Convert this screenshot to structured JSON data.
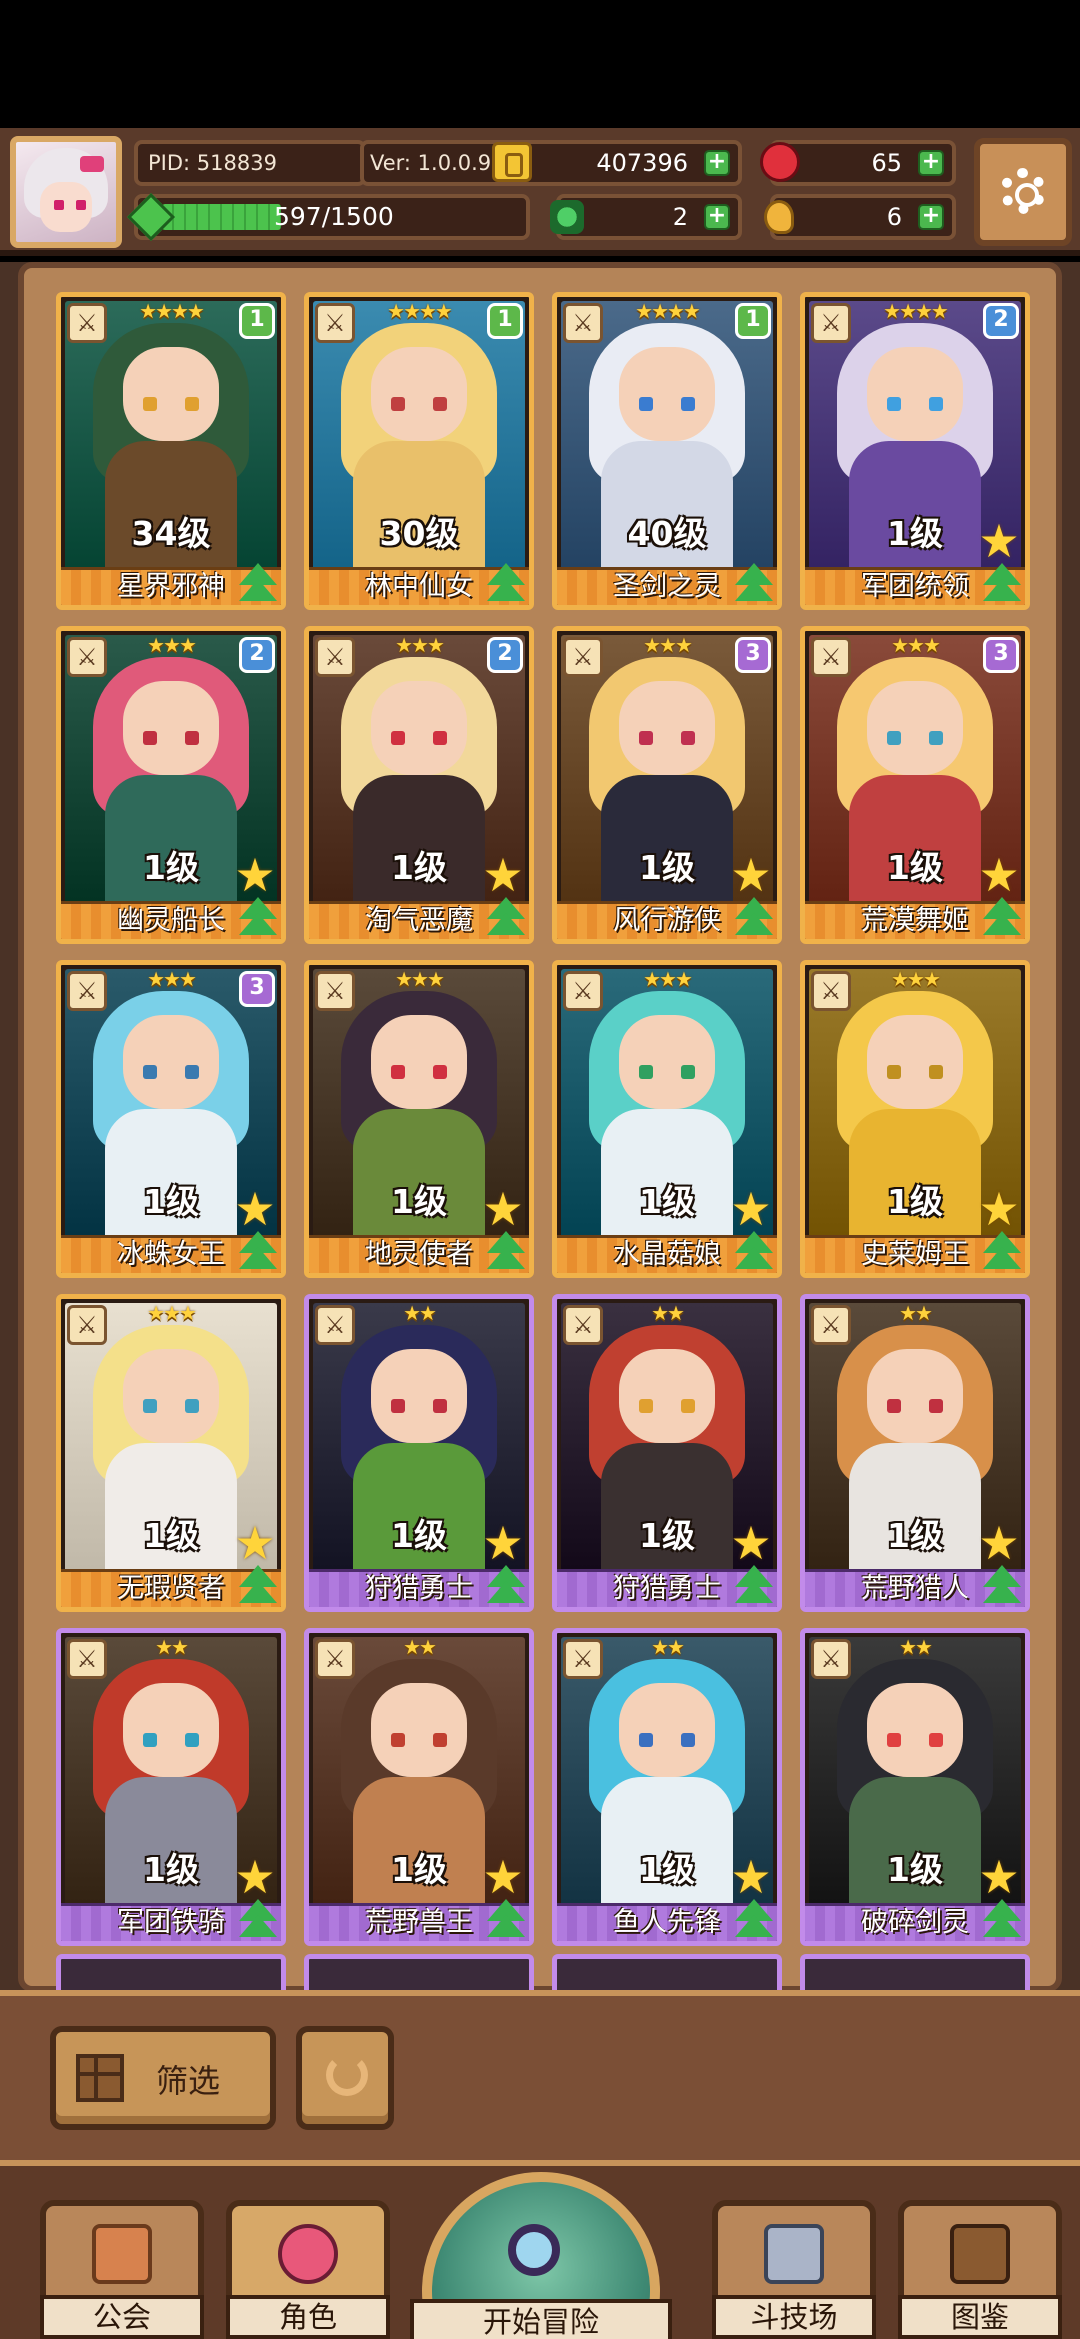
{
  "header": {
    "pid": "PID: 518839",
    "version": "Ver: 1.0.0.9",
    "gold": "407396",
    "gems": "65",
    "clover": "2",
    "food": "6",
    "xp": "597/1500",
    "xp_fraction": 0.398
  },
  "cards": [
    {
      "name": "星界邪神",
      "level": "34级",
      "stars": "★★★★",
      "badge": "1",
      "frame": "orange"
    },
    {
      "name": "林中仙女",
      "level": "30级",
      "stars": "★★★★",
      "badge": "1",
      "frame": "orange"
    },
    {
      "name": "圣剑之灵",
      "level": "40级",
      "stars": "★★★★",
      "badge": "1",
      "frame": "orange"
    },
    {
      "name": "军团统领",
      "level": "1级",
      "stars": "★★★★",
      "badge": "2",
      "frame": "orange"
    },
    {
      "name": "幽灵船长",
      "level": "1级",
      "stars": "★★★",
      "badge": "2",
      "frame": "orange"
    },
    {
      "name": "淘气恶魔",
      "level": "1级",
      "stars": "★★★",
      "badge": "2",
      "frame": "orange"
    },
    {
      "name": "风行游侠",
      "level": "1级",
      "stars": "★★★",
      "badge": "3",
      "frame": "orange"
    },
    {
      "name": "荒漠舞姬",
      "level": "1级",
      "stars": "★★★",
      "badge": "3",
      "frame": "orange"
    },
    {
      "name": "冰蛛女王",
      "level": "1级",
      "stars": "★★★",
      "badge": "3",
      "frame": "orange"
    },
    {
      "name": "地灵使者",
      "level": "1级",
      "stars": "★★★",
      "badge": "",
      "frame": "orange"
    },
    {
      "name": "水晶菇娘",
      "level": "1级",
      "stars": "★★★",
      "badge": "",
      "frame": "orange"
    },
    {
      "name": "史莱姆王",
      "level": "1级",
      "stars": "★★★",
      "badge": "",
      "frame": "orange"
    },
    {
      "name": "无瑕贤者",
      "level": "1级",
      "stars": "★★★",
      "badge": "",
      "frame": "orange"
    },
    {
      "name": "狩猎勇士",
      "level": "1级",
      "stars": "★★",
      "badge": "",
      "frame": "purple"
    },
    {
      "name": "狩猎勇士",
      "level": "1级",
      "stars": "★★",
      "badge": "",
      "frame": "purple"
    },
    {
      "name": "荒野猎人",
      "level": "1级",
      "stars": "★★",
      "badge": "",
      "frame": "purple"
    },
    {
      "name": "军团铁骑",
      "level": "1级",
      "stars": "★★",
      "badge": "",
      "frame": "purple"
    },
    {
      "name": "荒野兽王",
      "level": "1级",
      "stars": "★★",
      "badge": "",
      "frame": "purple"
    },
    {
      "name": "鱼人先锋",
      "level": "1级",
      "stars": "★★",
      "badge": "",
      "frame": "purple"
    },
    {
      "name": "破碎剑灵",
      "level": "1级",
      "stars": "★★",
      "badge": "",
      "frame": "purple"
    }
  ],
  "controls": {
    "filter_label": "筛选"
  },
  "nav": {
    "guild": "公会",
    "character": "角色",
    "adventure": "开始冒险",
    "arena": "斗技场",
    "codex": "图鉴"
  },
  "colors": {
    "panel_bg": "#b48458",
    "frame_orange": "#f0b24a",
    "frame_purple": "#c28bea",
    "badge_green": "#5db84a",
    "badge_blue": "#4a8fd8",
    "badge_purple": "#a66ad3"
  }
}
